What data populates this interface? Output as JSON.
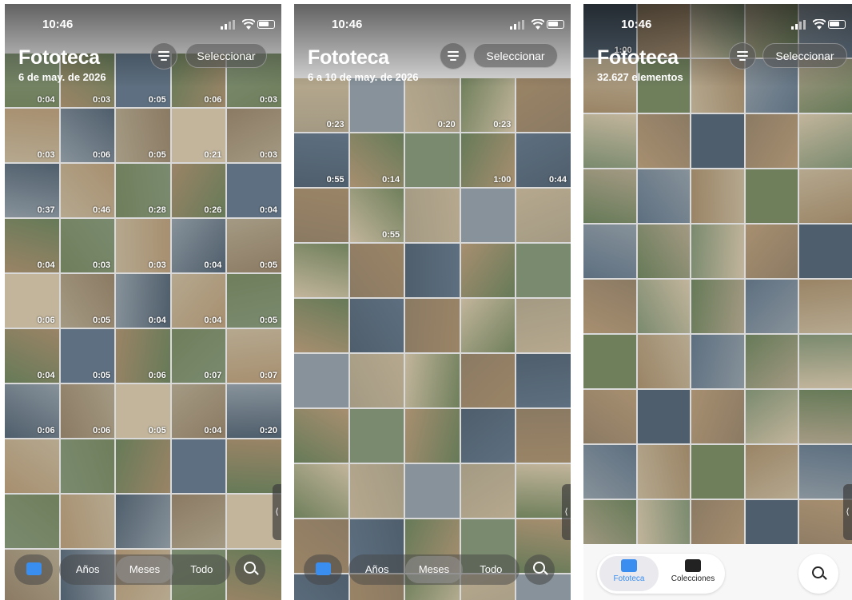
{
  "status_time": "10:46",
  "title": "Fototeca",
  "panels": [
    {
      "subtitle": "6 de may. de 2026",
      "select_label": "Seleccionar",
      "durations": [
        "0:04",
        "0:03",
        "0:05",
        "0:06",
        "0:03",
        "0:03",
        "0:06",
        "0:05",
        "0:21",
        "0:03",
        "0:37",
        "0:46",
        "0:28",
        "0:26",
        "0:04",
        "0:04",
        "0:03",
        "0:03",
        "0:04",
        "0:05",
        "0:06",
        "0:05",
        "0:04",
        "0:04",
        "0:05",
        "0:04",
        "0:05",
        "0:06",
        "0:07",
        "0:07",
        "0:06",
        "0:06",
        "0:05",
        "0:04",
        "0:20"
      ]
    },
    {
      "subtitle": "6 a 10 de may. de 2026",
      "select_label": "Seleccionar",
      "durations": [
        "0:23",
        "0:20",
        "0:23",
        "0:55",
        "0:14",
        "1:00",
        "0:44",
        "0:55"
      ]
    },
    {
      "subtitle": "32.627 elementos",
      "select_label": "Seleccionar",
      "durations": [
        "1:00"
      ]
    }
  ],
  "segments": {
    "years": "Años",
    "months": "Meses",
    "all": "Todo"
  },
  "side_tab": "⟨",
  "tabs": {
    "library": "Fototeca",
    "collections": "Colecciones"
  },
  "accent": "#3a8ef0"
}
